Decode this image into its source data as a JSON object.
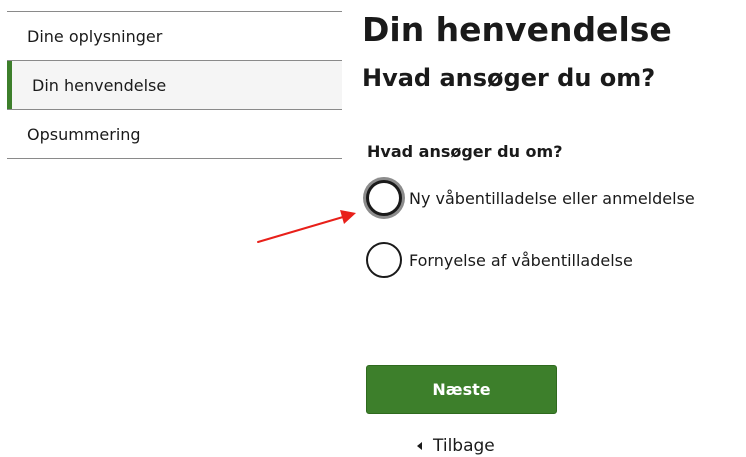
{
  "sidebar": {
    "steps": [
      {
        "label": "Dine oplysninger",
        "active": false
      },
      {
        "label": "Din henvendelse",
        "active": true
      },
      {
        "label": "Opsummering",
        "active": false
      }
    ]
  },
  "main": {
    "title": "Din henvendelse",
    "subtitle": "Hvad ansøger du om?",
    "question": "Hvad ansøger du om?",
    "options": [
      {
        "label": "Ny våbentilladelse eller anmeldelse",
        "selected": false,
        "focused": true
      },
      {
        "label": "Fornyelse af våbentilladelse",
        "selected": false,
        "focused": false
      }
    ],
    "next_label": "Næste",
    "back_label": "Tilbage"
  },
  "annotation": {
    "arrow_color": "#e8201a",
    "target": "radio-option-new-permit"
  },
  "colors": {
    "accent_green": "#3d7f2b",
    "divider": "#8a8a8a"
  }
}
